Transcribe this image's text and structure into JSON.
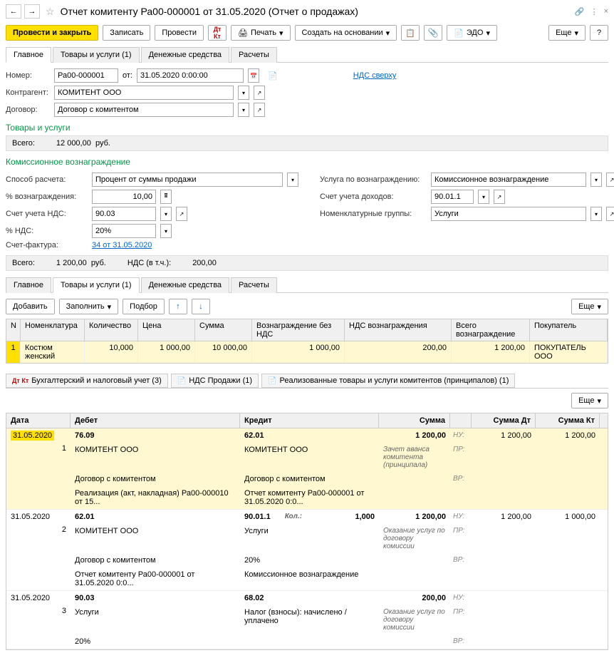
{
  "window": {
    "title": "Отчет комитенту Ра00-000001 от 31.05.2020 (Отчет о продажах)"
  },
  "toolbar": {
    "post_close": "Провести и закрыть",
    "save": "Записать",
    "post": "Провести",
    "print": "Печать",
    "create_based": "Создать на основании",
    "edo": "ЭДО",
    "more": "Еще"
  },
  "tabs_top": {
    "main": "Главное",
    "goods": "Товары и услуги (1)",
    "cash": "Денежные средства",
    "calc": "Расчеты"
  },
  "fields": {
    "number_label": "Номер:",
    "number": "Ра00-000001",
    "from": "от:",
    "date": "31.05.2020 0:00:00",
    "vat_link": "НДС сверху",
    "counterparty_label": "Контрагент:",
    "counterparty": "КОМИТЕНТ ООО",
    "contract_label": "Договор:",
    "contract": "Договор с комитентом"
  },
  "goods_section": {
    "title": "Товары и услуги",
    "total_label": "Всего:",
    "total": "12 000,00",
    "currency": "руб."
  },
  "commission": {
    "title": "Комиссионное вознаграждение",
    "method_label": "Способ расчета:",
    "method": "Процент от суммы продажи",
    "service_label": "Услуга по вознаграждению:",
    "service": "Комиссионное вознаграждение",
    "pct_label": "% вознаграждения:",
    "pct": "10,00",
    "income_acct_label": "Счет учета доходов:",
    "income_acct": "90.01.1",
    "vat_acct_label": "Счет учета НДС:",
    "vat_acct": "90.03",
    "nomen_label": "Номенклатурные группы:",
    "nomen": "Услуги",
    "vat_pct_label": "% НДС:",
    "vat_pct": "20%",
    "invoice_label": "Счет-фактура:",
    "invoice_link": "34 от 31.05.2020"
  },
  "totals2": {
    "total_label": "Всего:",
    "total": "1 200,00",
    "currency": "руб.",
    "vat_label": "НДС (в т.ч.):",
    "vat": "200,00"
  },
  "grid_tabs": {
    "main": "Главное",
    "goods": "Товары и услуги (1)",
    "cash": "Денежные средства",
    "calc": "Расчеты"
  },
  "grid_toolbar": {
    "add": "Добавить",
    "fill": "Заполнить",
    "select": "Подбор",
    "more": "Еще"
  },
  "grid": {
    "headers": {
      "n": "N",
      "nomen": "Номенклатура",
      "qty": "Количество",
      "price": "Цена",
      "sum": "Сумма",
      "fee_novat": "Вознаграждение без НДС",
      "fee_vat": "НДС вознаграждения",
      "fee_total": "Всего вознаграждение",
      "buyer": "Покупатель"
    },
    "rows": [
      {
        "n": "1",
        "nomen": "Костюм женский",
        "qty": "10,000",
        "price": "1 000,00",
        "sum": "10 000,00",
        "fee_novat": "1 000,00",
        "fee_vat": "200,00",
        "fee_total": "1 200,00",
        "buyer": "ПОКУПАТЕЛЬ ООО"
      }
    ]
  },
  "reg_tabs": {
    "acct": "Бухгалтерский и налоговый учет (3)",
    "vat": "НДС Продажи (1)",
    "real": "Реализованные товары и услуги комитентов (принципалов) (1)"
  },
  "acct": {
    "headers": {
      "date": "Дата",
      "debit": "Дебет",
      "credit": "Кредит",
      "sum": "Сумма",
      "sumd": "Сумма Дт",
      "sumk": "Сумма Кт"
    },
    "tags": {
      "nu": "НУ:",
      "pr": "ПР:",
      "vr": "ВР:"
    },
    "qty_label": "Кол.:",
    "entries": [
      {
        "date": "31.05.2020",
        "n": "1",
        "lines": [
          {
            "deb": "76.09",
            "cred": "62.01",
            "sum": "1 200,00",
            "sd": "1 200,00",
            "sk": "1 200,00"
          },
          {
            "deb": "КОМИТЕНТ ООО",
            "cred": "КОМИТЕНТ ООО",
            "note": "Зачет аванса комитента (принципала)"
          },
          {
            "deb": "Договор с комитентом",
            "cred": "Договор с комитентом"
          },
          {
            "deb": "Реализация (акт, накладная) Ра00-000010 от 15...",
            "cred": "Отчет комитенту Ра00-000001 от 31.05.2020 0:0..."
          }
        ],
        "hl": true
      },
      {
        "date": "31.05.2020",
        "n": "2",
        "lines": [
          {
            "deb": "62.01",
            "cred": "90.01.1",
            "cred2": "1,000",
            "sum": "1 200,00",
            "sd": "1 200,00",
            "sk": "1 000,00"
          },
          {
            "deb": "КОМИТЕНТ ООО",
            "cred": "Услуги",
            "note": "Оказание услуг по договору комиссии"
          },
          {
            "deb": "Договор с комитентом",
            "cred": "20%"
          },
          {
            "deb": "Отчет комитенту Ра00-000001 от 31.05.2020 0:0...",
            "cred": "Комиссионное вознаграждение"
          }
        ]
      },
      {
        "date": "31.05.2020",
        "n": "3",
        "lines": [
          {
            "deb": "90.03",
            "cred": "68.02",
            "sum": "200,00"
          },
          {
            "deb": "Услуги",
            "cred": "Налог (взносы): начислено / уплачено",
            "note": "Оказание услуг по договору комиссии"
          },
          {
            "deb": "20%"
          }
        ]
      }
    ]
  }
}
